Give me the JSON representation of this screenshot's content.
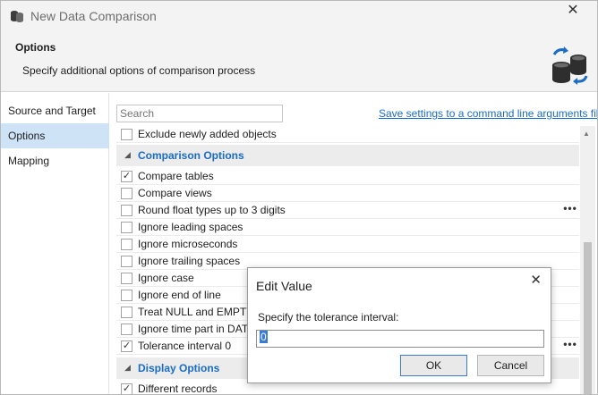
{
  "window": {
    "title": "New Data Comparison",
    "close_glyph": "✕",
    "app_icon": "database-compare-icon"
  },
  "header": {
    "title": "Options",
    "subtitle": "Specify additional options of comparison process",
    "icon": "database-sync-icon"
  },
  "sidebar": {
    "items": [
      {
        "label": "Source and Target",
        "active": false
      },
      {
        "label": "Options",
        "active": true
      },
      {
        "label": "Mapping",
        "active": false
      }
    ]
  },
  "toolbar": {
    "search_placeholder": "Search",
    "save_link": "Save settings to a command line arguments file..."
  },
  "options": {
    "row_exclude": {
      "label": "Exclude newly added objects",
      "checked": false
    },
    "comparison_section": "Comparison Options",
    "comparison": [
      {
        "label": "Compare tables",
        "checked": true
      },
      {
        "label": "Compare views",
        "checked": false
      },
      {
        "label": "Round float types up to 3 digits",
        "checked": false,
        "more": "•••"
      },
      {
        "label": "Ignore leading spaces",
        "checked": false
      },
      {
        "label": "Ignore microseconds",
        "checked": false
      },
      {
        "label": "Ignore trailing spaces",
        "checked": false
      },
      {
        "label": "Ignore case",
        "checked": false
      },
      {
        "label": "Ignore end of line",
        "checked": false
      },
      {
        "label": "Treat NULL and EMPTY ST",
        "checked": false
      },
      {
        "label": "Ignore time part in DATET",
        "checked": false
      },
      {
        "label": "Tolerance interval 0",
        "checked": true,
        "more": "•••"
      }
    ],
    "display_section": "Display Options",
    "display": [
      {
        "label": "Different records",
        "checked": true
      }
    ],
    "check_glyph": "✓"
  },
  "dialog": {
    "title": "Edit Value",
    "close_glyph": "✕",
    "prompt": "Specify the tolerance interval:",
    "value": "0",
    "ok_label": "OK",
    "cancel_label": "Cancel"
  },
  "colors": {
    "accent": "#1a6cc4",
    "selected_nav": "#cfe3f7",
    "section_bg": "#ececec"
  }
}
